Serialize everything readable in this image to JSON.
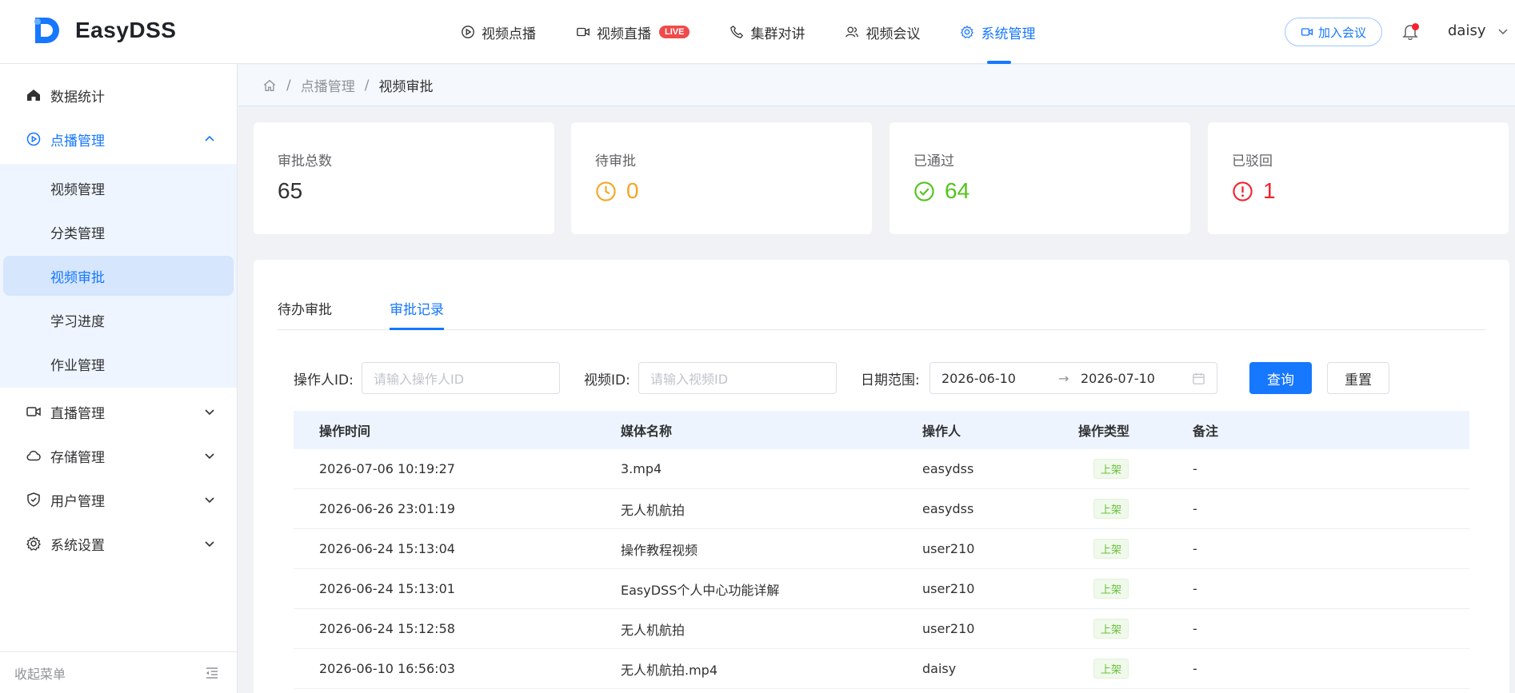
{
  "header": {
    "logo_text": "EasyDSS",
    "nav": [
      {
        "label": "视频点播",
        "icon": "play-circle-icon"
      },
      {
        "label": "视频直播",
        "icon": "video-camera-icon",
        "badge": "LIVE"
      },
      {
        "label": "集群对讲",
        "icon": "phone-icon"
      },
      {
        "label": "视频会议",
        "icon": "users-icon"
      },
      {
        "label": "系统管理",
        "icon": "gear-icon",
        "active": true
      }
    ],
    "join_label": "加入会议",
    "username": "daisy"
  },
  "sidebar": {
    "items": [
      {
        "label": "数据统计",
        "icon": "home-icon"
      },
      {
        "label": "点播管理",
        "icon": "play-circle-icon",
        "open": true
      },
      {
        "label": "直播管理",
        "icon": "video-camera-icon"
      },
      {
        "label": "存储管理",
        "icon": "cloud-icon"
      },
      {
        "label": "用户管理",
        "icon": "shield-icon"
      },
      {
        "label": "系统设置",
        "icon": "gear-icon"
      }
    ],
    "subitems": [
      "视频管理",
      "分类管理",
      "视频审批",
      "学习进度",
      "作业管理"
    ],
    "active_subitem": "视频审批",
    "collapse_label": "收起菜单"
  },
  "breadcrumb": {
    "parent": "点播管理",
    "current": "视频审批"
  },
  "stats": [
    {
      "label": "审批总数",
      "value": "65",
      "color": "#303133"
    },
    {
      "label": "待审批",
      "value": "0",
      "color": "#f5a623"
    },
    {
      "label": "已通过",
      "value": "64",
      "color": "#52c41a"
    },
    {
      "label": "已驳回",
      "value": "1",
      "color": "#f5222d"
    }
  ],
  "tabs": {
    "pending": "待办审批",
    "records": "审批记录"
  },
  "filters": {
    "operator_label": "操作人ID:",
    "operator_placeholder": "请输入操作人ID",
    "video_label": "视频ID:",
    "video_placeholder": "请输入视频ID",
    "date_label": "日期范围:",
    "date_start": "2026-06-10",
    "date_arrow": "→",
    "date_end": "2026-07-10",
    "query_label": "查询",
    "reset_label": "重置"
  },
  "table": {
    "columns": [
      "操作时间",
      "媒体名称",
      "操作人",
      "操作类型",
      "备注"
    ],
    "rows": [
      {
        "time": "2026-07-06 10:19:27",
        "media": "3.mp4",
        "operator": "easydss",
        "type": "上架",
        "note": "-"
      },
      {
        "time": "2026-06-26 23:01:19",
        "media": "无人机航拍",
        "operator": "easydss",
        "type": "上架",
        "note": "-"
      },
      {
        "time": "2026-06-24 15:13:04",
        "media": "操作教程视频",
        "operator": "user210",
        "type": "上架",
        "note": "-"
      },
      {
        "time": "2026-06-24 15:13:01",
        "media": "EasyDSS个人中心功能详解",
        "operator": "user210",
        "type": "上架",
        "note": "-"
      },
      {
        "time": "2026-06-24 15:12:58",
        "media": "无人机航拍",
        "operator": "user210",
        "type": "上架",
        "note": "-"
      },
      {
        "time": "2026-06-10 16:56:03",
        "media": "无人机航拍.mp4",
        "operator": "daisy",
        "type": "上架",
        "note": "-"
      }
    ]
  },
  "accent_color": "#1677ff"
}
